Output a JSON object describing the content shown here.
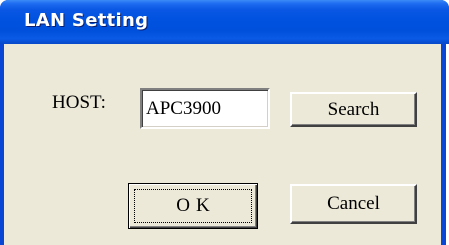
{
  "window": {
    "title": "LAN Setting"
  },
  "form": {
    "host_label": "HOST:",
    "host_value": "APC3900"
  },
  "buttons": {
    "search_label": "Search",
    "ok_label": "OK",
    "cancel_label": "Cancel"
  },
  "colors": {
    "titlebar": "#0052df",
    "dialog_background": "#ece9d8",
    "title_text": "#ffffff"
  }
}
